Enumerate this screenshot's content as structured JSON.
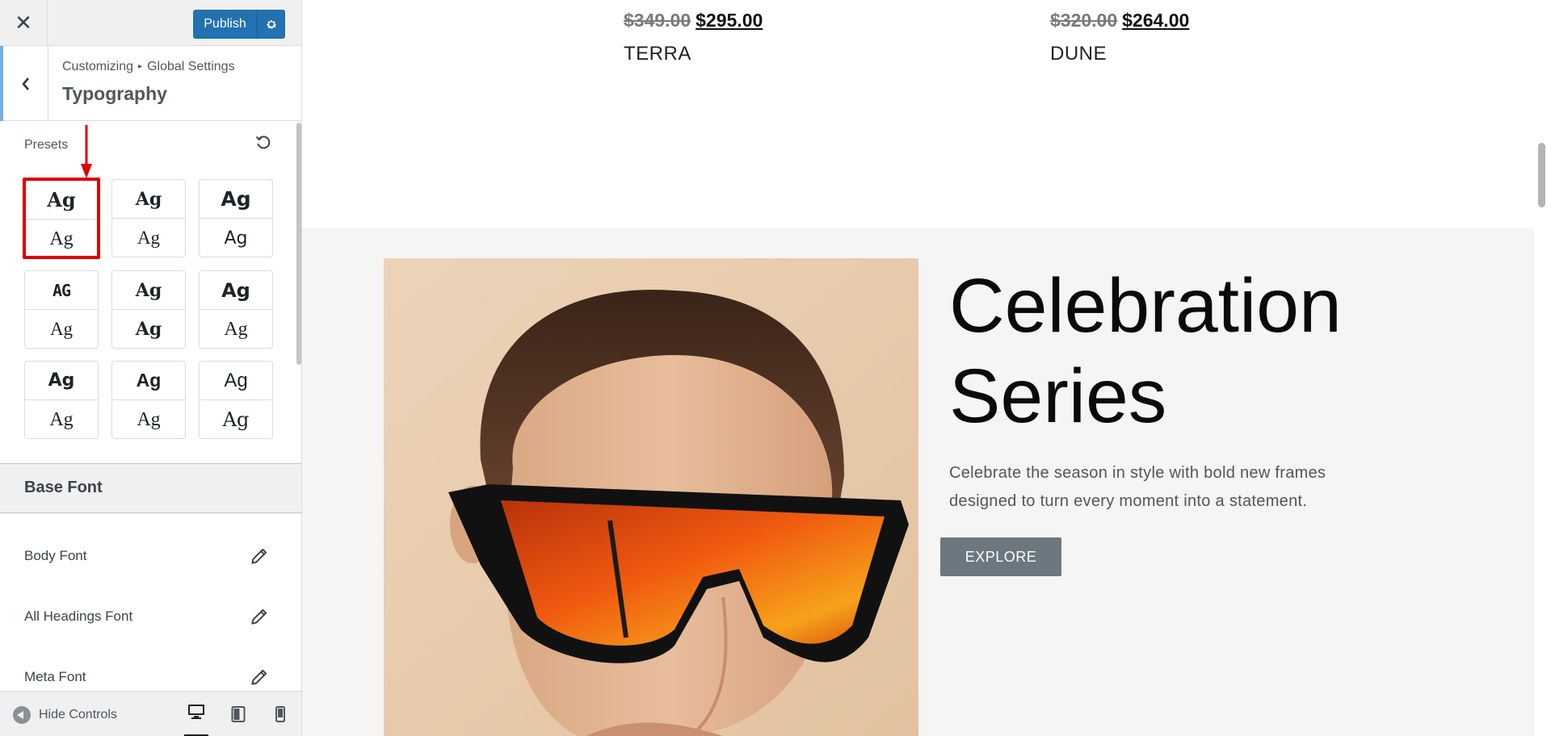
{
  "topbar": {
    "close_icon": "close-icon",
    "publish_label": "Publish",
    "settings_icon": "gear-icon"
  },
  "header": {
    "breadcrumb_root": "Customizing",
    "breadcrumb_sep": "▸",
    "breadcrumb_current": "Global Settings",
    "title": "Typography"
  },
  "presets": {
    "label": "Presets",
    "items": [
      {
        "top": "Ag",
        "bottom": "Ag",
        "selected": true
      },
      {
        "top": "Ag",
        "bottom": "Ag",
        "selected": false
      },
      {
        "top": "Ag",
        "bottom": "Ag",
        "selected": false
      },
      {
        "top": "AG",
        "bottom": "Ag",
        "selected": false
      },
      {
        "top": "Ag",
        "bottom": "Ag",
        "selected": false
      },
      {
        "top": "Ag",
        "bottom": "Ag",
        "selected": false
      },
      {
        "top": "Ag",
        "bottom": "Ag",
        "selected": false
      },
      {
        "top": "Ag",
        "bottom": "Ag",
        "selected": false
      },
      {
        "top": "Ag",
        "bottom": "Ag",
        "selected": false
      }
    ]
  },
  "base_font": {
    "heading": "Base Font",
    "rows": [
      {
        "label": "Body Font"
      },
      {
        "label": "All Headings Font"
      },
      {
        "label": "Meta Font"
      }
    ]
  },
  "footer": {
    "hide_controls": "Hide Controls",
    "devices": [
      "desktop-icon",
      "tablet-icon",
      "mobile-icon"
    ]
  },
  "preview": {
    "products": [
      {
        "old_price": "$349.00",
        "new_price": "$295.00",
        "name": "TERRA"
      },
      {
        "old_price": "$320.00",
        "new_price": "$264.00",
        "name": "DUNE"
      }
    ],
    "hero": {
      "title_line1": "Celebration",
      "title_line2": "Series",
      "description": "Celebrate the season in style with bold new frames designed to turn every moment into a statement.",
      "button": "EXPLORE"
    }
  },
  "colors": {
    "publish": "#2271b1",
    "highlight": "#e10000",
    "explore": "#6c7780"
  }
}
